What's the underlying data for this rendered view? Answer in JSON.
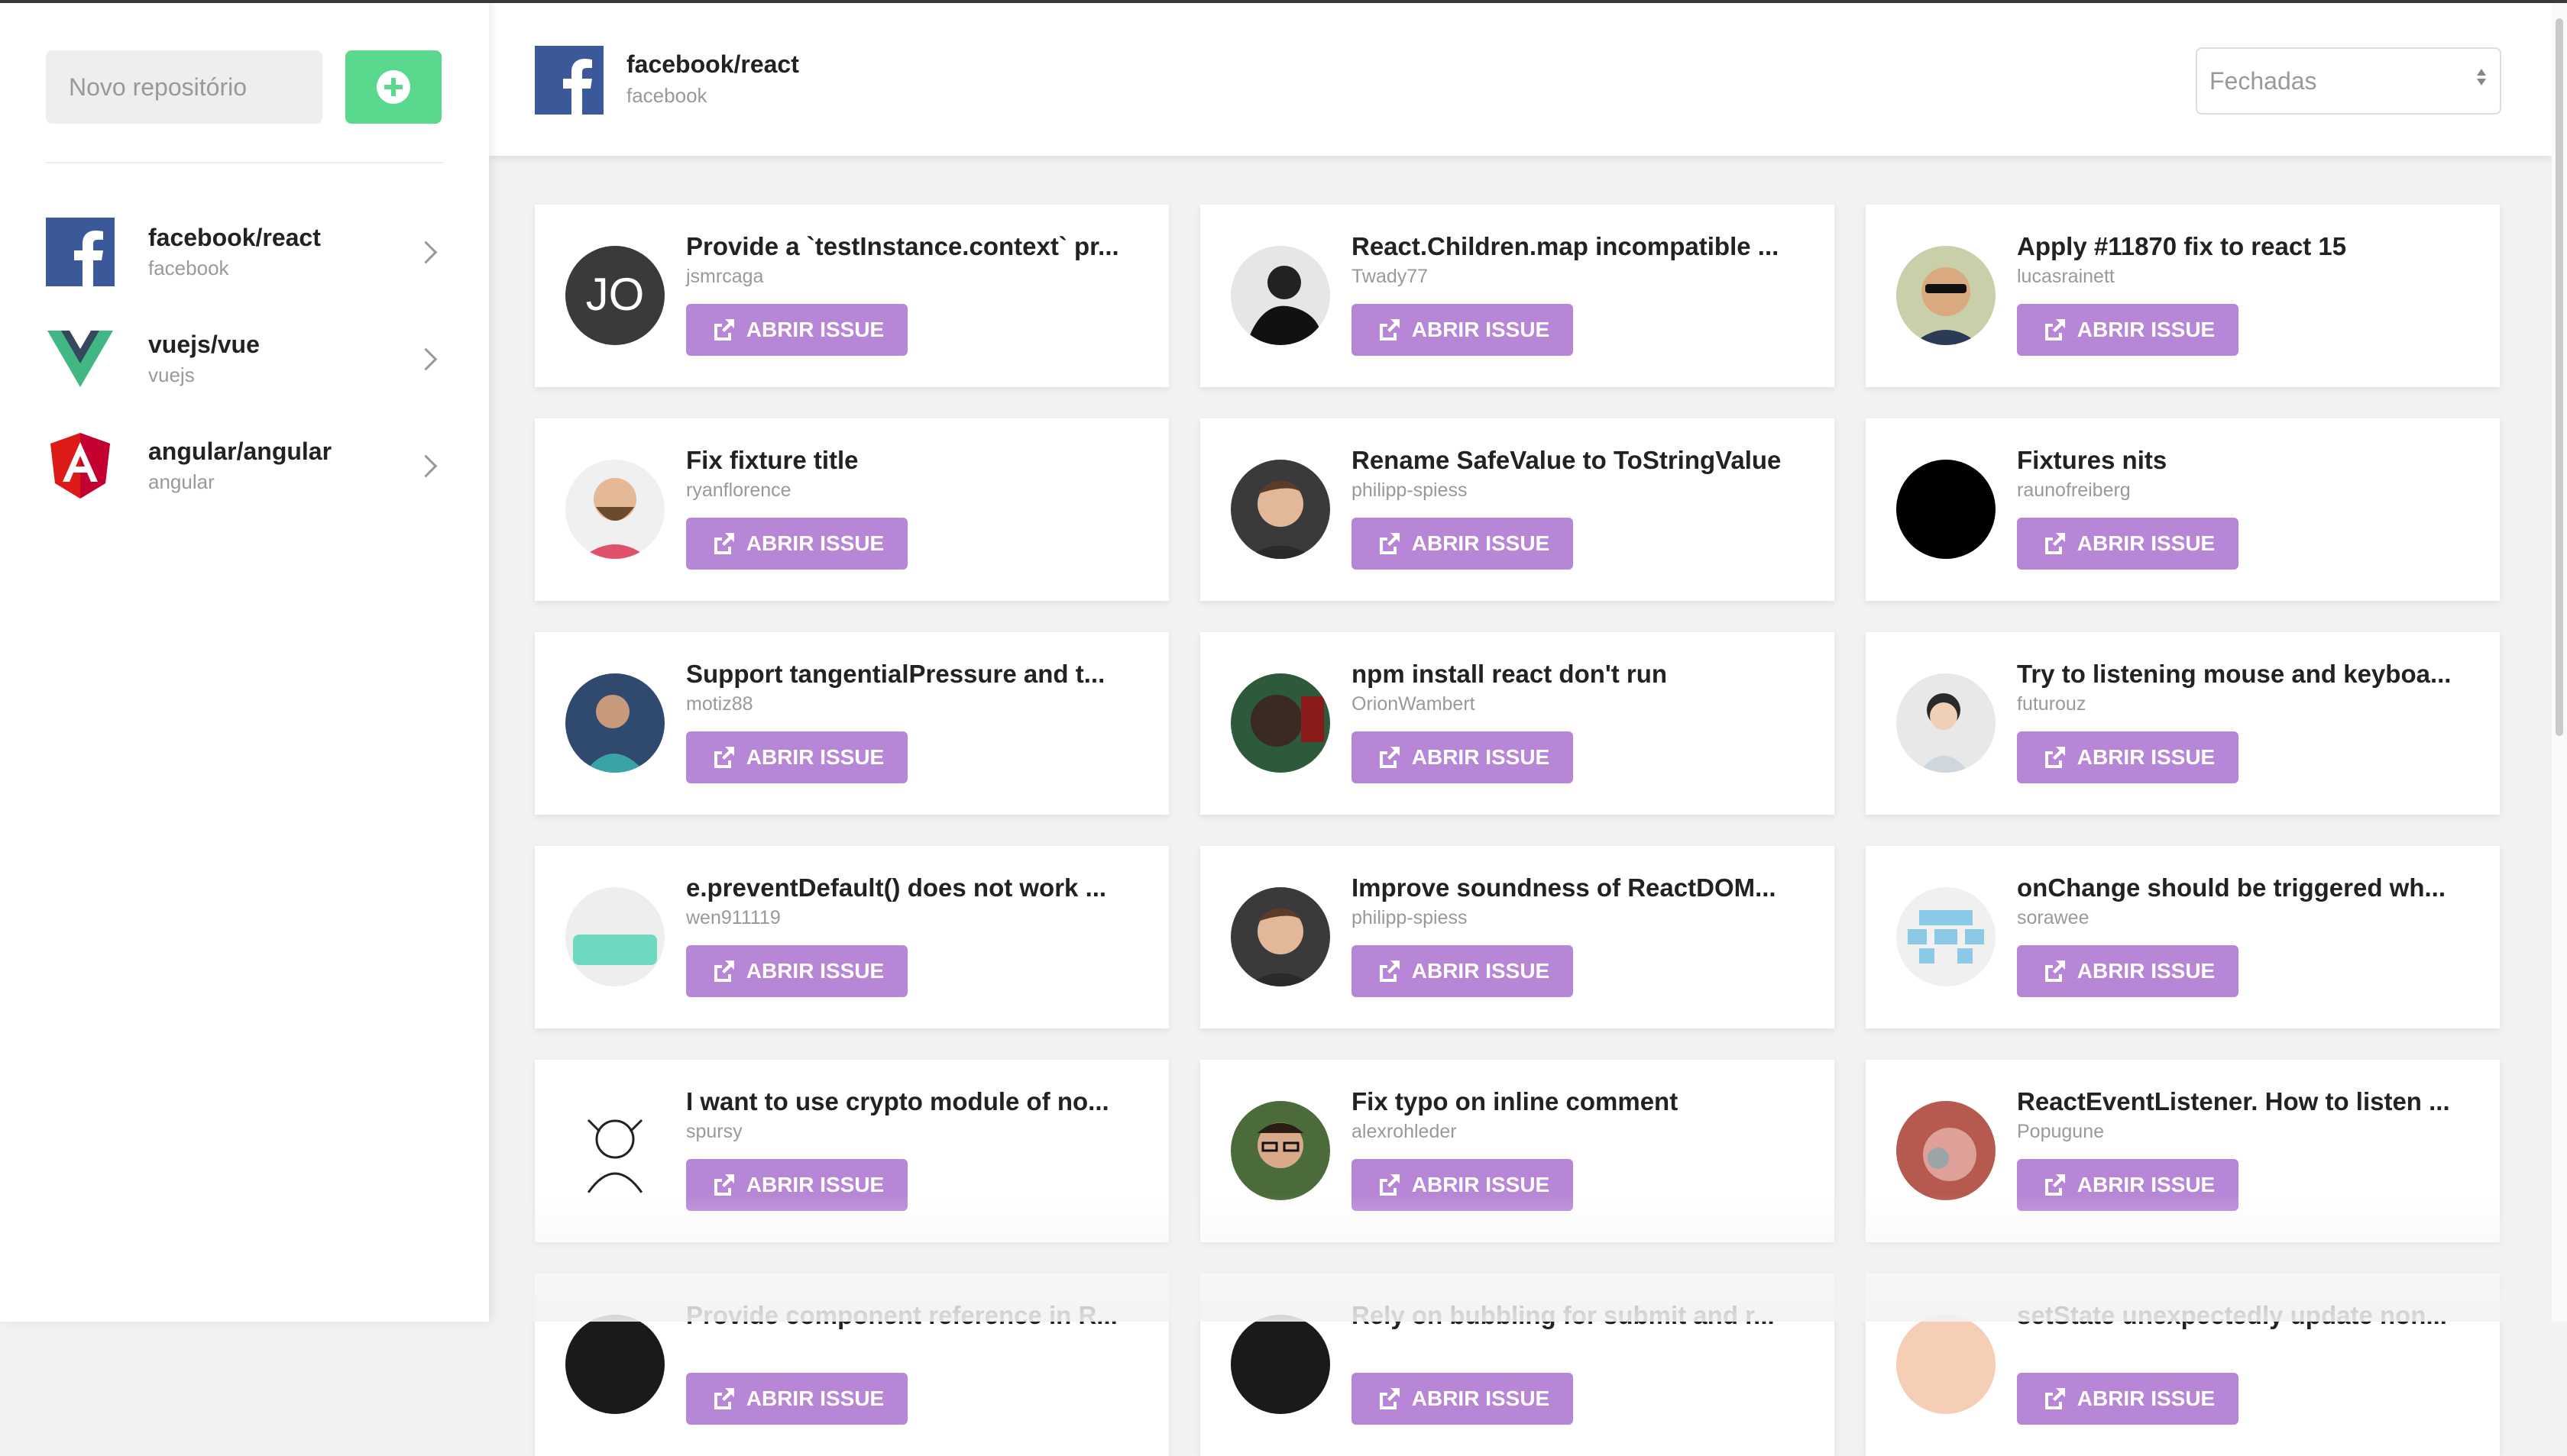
{
  "sidebar": {
    "new_repo_placeholder": "Novo repositório",
    "add_button_icon": "plus-circle-icon",
    "repos": [
      {
        "name": "facebook/react",
        "owner": "facebook",
        "logo": "facebook-logo"
      },
      {
        "name": "vuejs/vue",
        "owner": "vuejs",
        "logo": "vue-logo"
      },
      {
        "name": "angular/angular",
        "owner": "angular",
        "logo": "angular-logo"
      }
    ]
  },
  "header": {
    "title": "facebook/react",
    "owner": "facebook",
    "state_filter": "Fechadas"
  },
  "button_label": "ABRIR ISSUE",
  "colors": {
    "accent_purple": "#b786d6",
    "add_green": "#59d98e",
    "facebook_blue": "#3b5998"
  },
  "issues": [
    {
      "title": "Provide a `testInstance.context` pr...",
      "user": "jsmrcaga",
      "avatar": "avatar-jo-logo"
    },
    {
      "title": "React.Children.map incompatible ...",
      "user": "Twady77",
      "avatar": "avatar-photo-bw"
    },
    {
      "title": "Apply #11870 fix to react 15",
      "user": "lucasrainett",
      "avatar": "avatar-photo-sunglasses"
    },
    {
      "title": "Fix fixture title",
      "user": "ryanflorence",
      "avatar": "avatar-photo-beard"
    },
    {
      "title": "Rename SafeValue to ToStringValue",
      "user": "philipp-spiess",
      "avatar": "avatar-photo-man"
    },
    {
      "title": "Fixtures nits",
      "user": "raunofreiberg",
      "avatar": "avatar-black-circle"
    },
    {
      "title": "Support tangentialPressure and t...",
      "user": "motiz88",
      "avatar": "avatar-photo-blue"
    },
    {
      "title": "npm install react don't run",
      "user": "OrionWambert",
      "avatar": "avatar-photo-dark"
    },
    {
      "title": "Try to listening mouse and keyboa...",
      "user": "futurouz",
      "avatar": "avatar-photo-light"
    },
    {
      "title": "e.preventDefault() does not work ...",
      "user": "wen911119",
      "avatar": "avatar-teal-shape"
    },
    {
      "title": "Improve soundness of ReactDOM...",
      "user": "philipp-spiess",
      "avatar": "avatar-photo-man"
    },
    {
      "title": "onChange should be triggered wh...",
      "user": "sorawee",
      "avatar": "avatar-identicon"
    },
    {
      "title": "I want to use crypto module of no...",
      "user": "spursy",
      "avatar": "avatar-sketch"
    },
    {
      "title": "Fix typo on inline comment",
      "user": "alexrohleder",
      "avatar": "avatar-photo-glasses"
    },
    {
      "title": "ReactEventListener. How to listen ...",
      "user": "Popugune",
      "avatar": "avatar-photo-pink"
    },
    {
      "title": "Provide component reference in R...",
      "user": "",
      "avatar": "avatar-dark"
    },
    {
      "title": "Rely on bubbling for submit and r...",
      "user": "",
      "avatar": "avatar-dark"
    },
    {
      "title": "setState unexpectedly update non...",
      "user": "",
      "avatar": "avatar-peach"
    }
  ]
}
